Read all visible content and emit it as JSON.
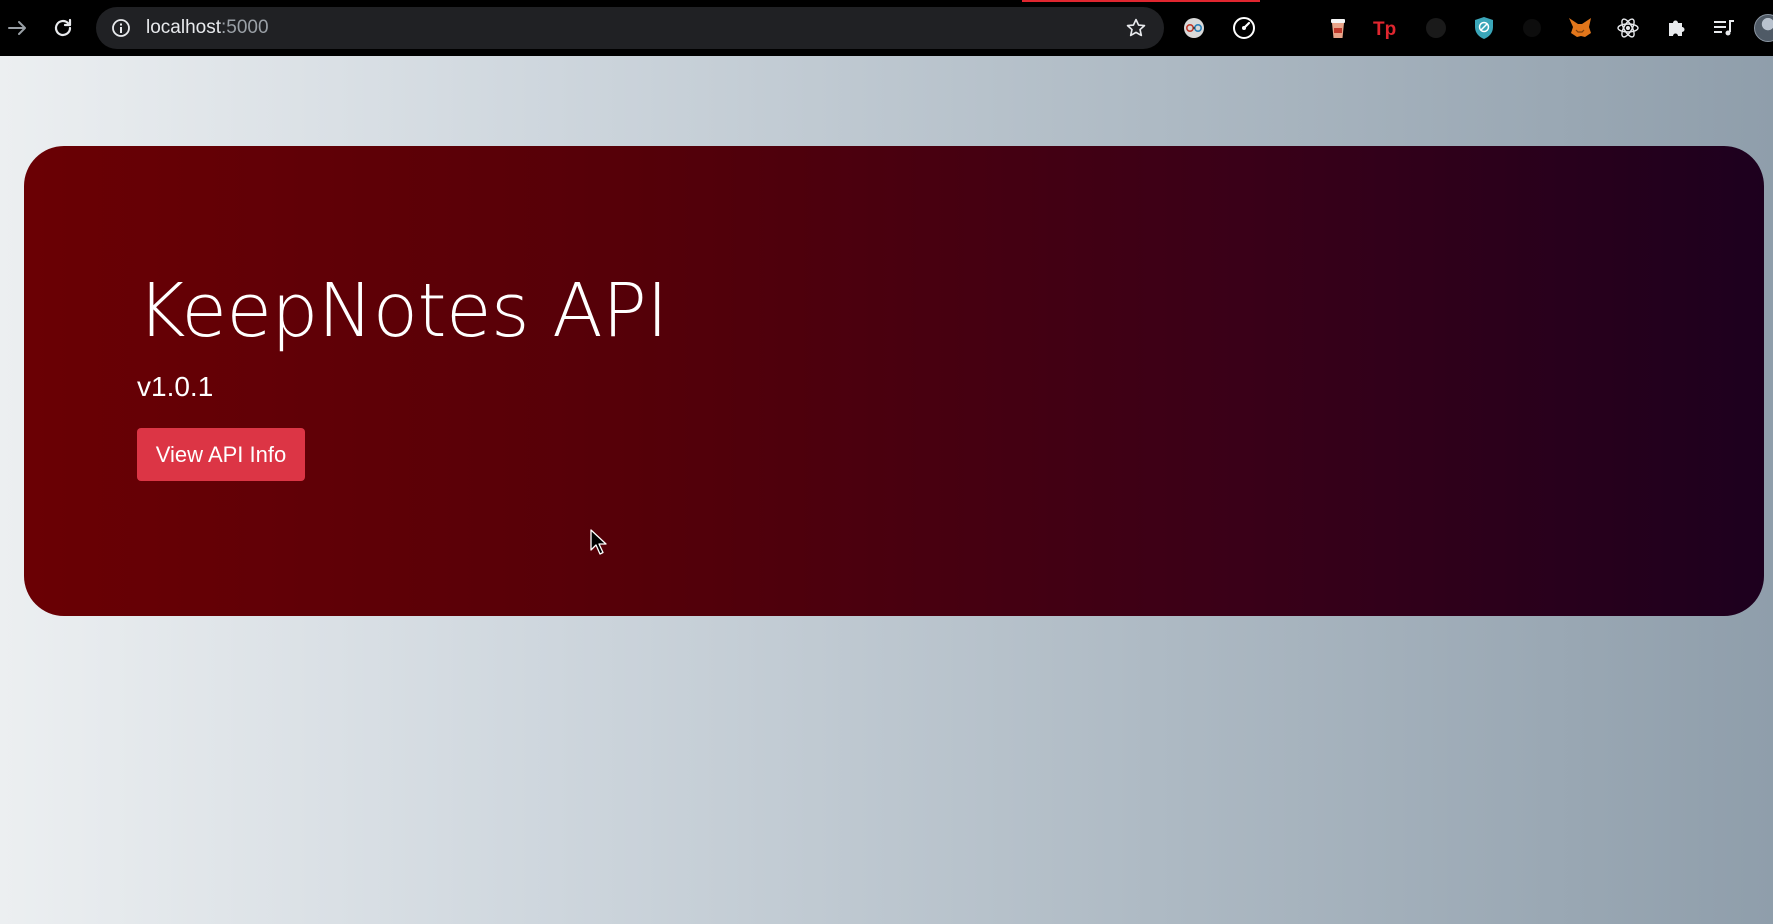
{
  "browser": {
    "url_host": "localhost",
    "url_port": ":5000",
    "accent": "#e0262f",
    "nav_icons": [
      "forward-arrow-icon",
      "reload-icon"
    ],
    "extensions": [
      "chrome-dev-editor-icon",
      "speedometer-icon",
      "coffee-cup-icon",
      "tp-icon",
      "github-icon",
      "shield-icon",
      "ghost-icon",
      "metamask-fox-icon",
      "react-atom-icon",
      "puzzle-piece-icon",
      "playlist-icon"
    ]
  },
  "hero": {
    "title": "KeepNotes API",
    "version": "v1.0.1",
    "button_label": "View API Info",
    "button_color": "#dc3545"
  }
}
